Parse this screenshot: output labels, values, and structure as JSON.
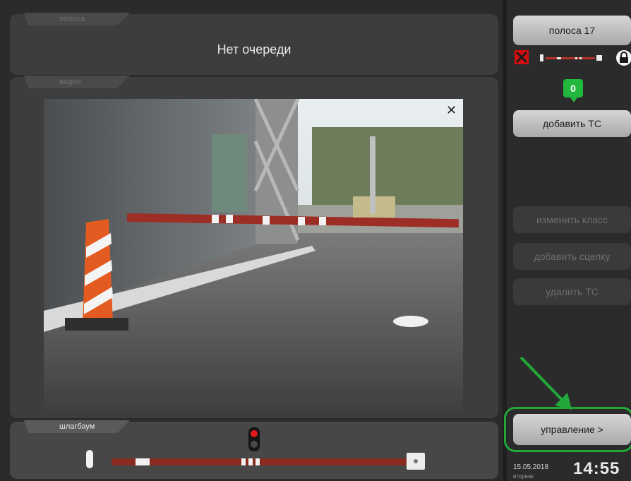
{
  "queue": {
    "tab_label": "полоса",
    "status_text": "Нет очереди"
  },
  "video": {
    "tab_label": "видео",
    "close_icon": "close-icon"
  },
  "barrier": {
    "tab_label": "шлагбаум",
    "traffic_light_state": "red"
  },
  "sidebar": {
    "lane_label": "полоса 17",
    "vehicle_count": "0",
    "add_vehicle_label": "добавить ТС",
    "change_class_label": "изменить класс",
    "add_trailer_label": "добавить сцепку",
    "delete_vehicle_label": "удалить ТС",
    "control_label": "управление >"
  },
  "footer": {
    "date": "15.05.2018",
    "weekday": "вторник",
    "time": "14:55"
  },
  "colors": {
    "accent_green": "#21a839",
    "barrier_red": "#8b2b1f",
    "background": "#2b2b2b"
  }
}
